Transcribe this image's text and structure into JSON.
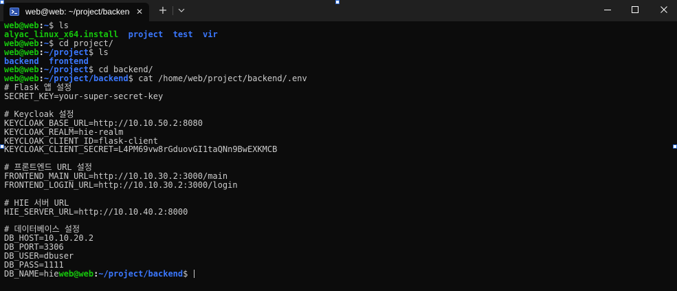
{
  "titlebar": {
    "tab_title": "web@web: ~/project/backend",
    "tab_icon": "terminal-icon",
    "close_icon": "close-icon",
    "new_tab": "+",
    "dropdown_icon": "chevron-down-icon",
    "minimize_icon": "minimize-icon",
    "maximize_icon": "maximize-icon",
    "window_close_icon": "close-icon"
  },
  "colors": {
    "prompt_user": "#16c60c",
    "prompt_path": "#3b78ff",
    "text": "#cccccc",
    "background": "#0c0c0c",
    "titlebar": "#202020"
  },
  "terminal": {
    "l1": {
      "user": "web@web",
      "sep": ":",
      "path": "~",
      "cmd": "$ ls"
    },
    "l2": {
      "f1": "alyac_linux_x64.install",
      "f2": "project",
      "f3": "test",
      "f4": "vir"
    },
    "l3": {
      "user": "web@web",
      "sep": ":",
      "path": "~",
      "cmd": "$ cd project/"
    },
    "l4": {
      "user": "web@web",
      "sep": ":",
      "path": "~/project",
      "cmd": "$ ls"
    },
    "l5": {
      "f1": "backend",
      "f2": "frontend"
    },
    "l6": {
      "user": "web@web",
      "sep": ":",
      "path": "~/project",
      "cmd": "$ cd backend/"
    },
    "l7": {
      "user": "web@web",
      "sep": ":",
      "path": "~/project/backend",
      "cmd": "$ cat /home/web/project/backend/.env"
    },
    "env": [
      "# Flask 앱 설정",
      "SECRET_KEY=your-super-secret-key",
      "",
      "# Keycloak 설정",
      "KEYCLOAK_BASE_URL=http://10.10.50.2:8080",
      "KEYCLOAK_REALM=hie-realm",
      "KEYCLOAK_CLIENT_ID=flask-client",
      "KEYCLOAK_CLIENT_SECRET=L4PM69vw8rGduovGI1taQNn9BwEXKMCB",
      "",
      "# 프론트엔드 URL 설정",
      "FRONTEND_MAIN_URL=http://10.10.30.2:3000/main",
      "FRONTEND_LOGIN_URL=http://10.10.30.2:3000/login",
      "",
      "# HIE 서버 URL",
      "HIE_SERVER_URL=http://10.10.40.2:8000",
      "",
      "# 데이터베이스 설정",
      "DB_HOST=10.10.20.2",
      "DB_PORT=3306",
      "DB_USER=dbuser",
      "DB_PASS=1111"
    ],
    "last": {
      "text": "DB_NAME=hie",
      "user": "web@web",
      "sep": ":",
      "path": "~/project/backend",
      "cmd": "$ "
    }
  }
}
